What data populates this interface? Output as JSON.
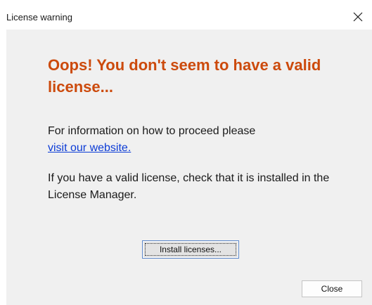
{
  "window": {
    "title": "License warning"
  },
  "icons": {
    "close": "close-icon"
  },
  "message": {
    "headline": "Oops! You don't seem to have a valid license...",
    "info_prefix": "For information on how to proceed please",
    "link_text": "visit our website.",
    "check_text": "If you have a valid license, check that it is installed in the License Manager."
  },
  "buttons": {
    "install_label": "Install licenses...",
    "close_label": "Close"
  },
  "colors": {
    "headline": "#cc4a0c",
    "link": "#0b3bd6",
    "panel": "#f0f0f0"
  }
}
